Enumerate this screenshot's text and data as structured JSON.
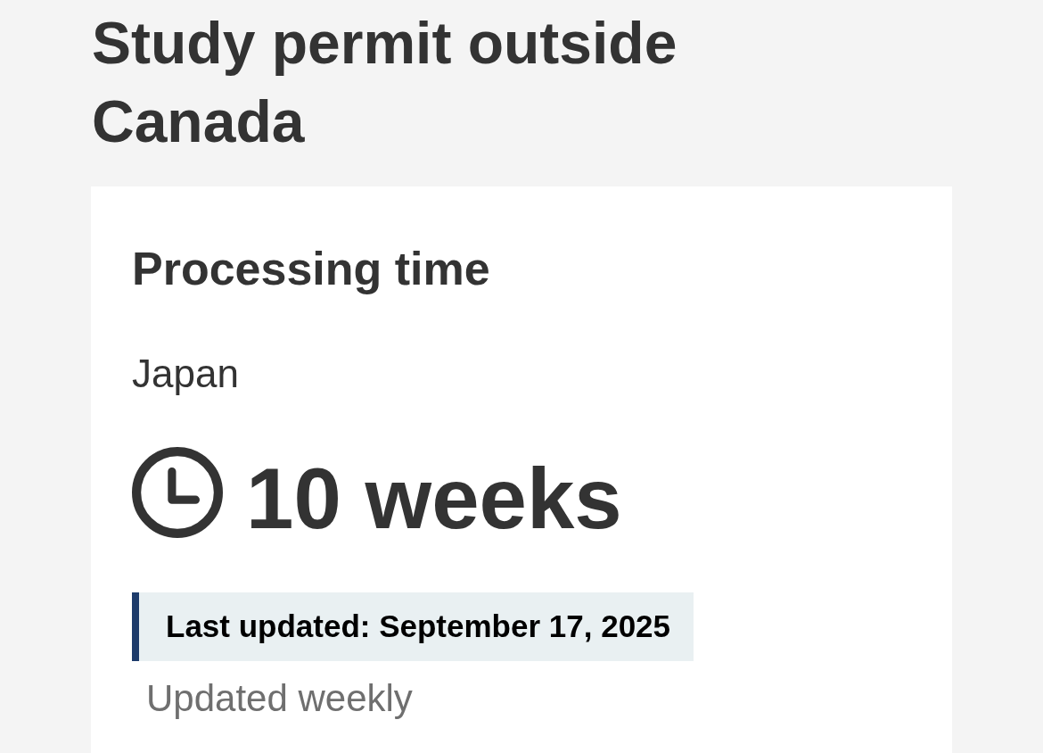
{
  "page": {
    "title": "Study permit outside Canada"
  },
  "card": {
    "heading": "Processing time",
    "country": "Japan",
    "processing_time": "10 weeks",
    "last_updated": "Last updated: September 17, 2025",
    "update_frequency": "Updated weekly"
  }
}
